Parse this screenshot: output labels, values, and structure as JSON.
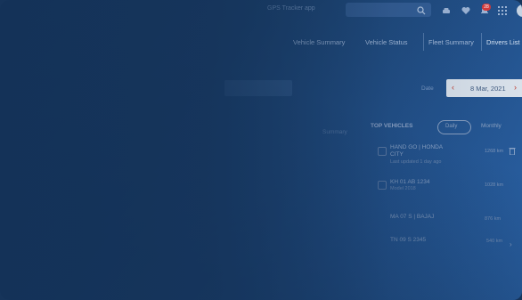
{
  "topbar": {
    "text": "GPS Tracker app",
    "notification_count": "28"
  },
  "nav": {
    "items": [
      {
        "label": "Vehicle Summary"
      },
      {
        "label": "Vehicle Status"
      },
      {
        "label": "Fleet Summary"
      },
      {
        "label": "Drivers List"
      }
    ]
  },
  "date_picker": {
    "label": "Date",
    "value": "8 Mar, 2021",
    "prev": "‹",
    "next": "›"
  },
  "panel": {
    "title": "TOP VEHICLES",
    "left_label": "Summary",
    "filter_label": "Daily",
    "right_label": "Monthly",
    "rows": [
      {
        "title": "HAND GO | HONDA",
        "title2": "CITY",
        "sub": "Last updated 1 day ago",
        "value": "1268 km"
      },
      {
        "title": "KH 01 AB 1234",
        "title2": "",
        "sub": "Model 2018",
        "value": "1028 km"
      },
      {
        "title": "MA 07 S | BAJAJ",
        "title2": "",
        "sub": "",
        "value": "876 km"
      },
      {
        "title": "TN 09 S 2345",
        "title2": "",
        "sub": "",
        "value": "540 km"
      }
    ]
  }
}
